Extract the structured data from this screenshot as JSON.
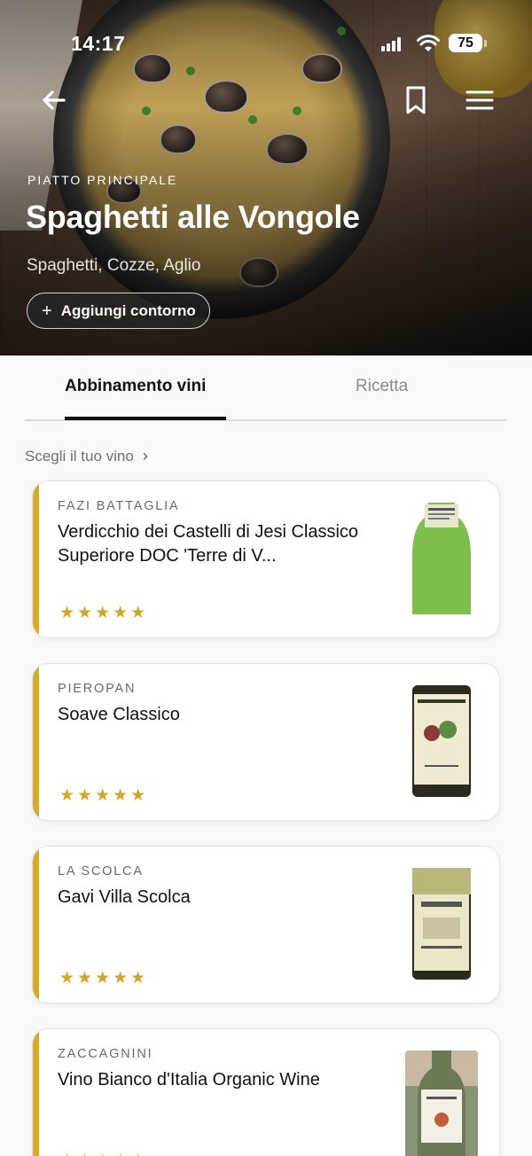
{
  "status": {
    "time": "14:17",
    "battery": "75"
  },
  "hero": {
    "course": "PIATTO PRINCIPALE",
    "title": "Spaghetti alle Vongole",
    "ingredients": "Spaghetti, Cozze, Aglio",
    "add_side_label": "Aggiungi contorno"
  },
  "tabs": [
    {
      "label": "Abbinamento vini",
      "active": true
    },
    {
      "label": "Ricetta",
      "active": false
    }
  ],
  "choose_label": "Scegli il tuo vino",
  "wines": [
    {
      "producer": "FAZI BATTAGLIA",
      "name": "Verdicchio dei Castelli di Jesi Classico Superiore DOC 'Terre di V...",
      "rating": "★★★★★",
      "bottle_color": "#7cbf4a",
      "label_color": "#e9e4cf"
    },
    {
      "producer": "PIEROPAN",
      "name": "Soave Classico",
      "rating": "★★★★★",
      "bottle_color": "#2b2a1e",
      "label_color": "#f1ead2"
    },
    {
      "producer": "LA SCOLCA",
      "name": "Gavi Villa Scolca",
      "rating": "★★★★★",
      "bottle_color": "#2a2a1a",
      "label_color": "#ece6c8"
    },
    {
      "producer": "ZACCAGNINI",
      "name": "Vino Bianco d'Italia Organic Wine",
      "rating": "★★★★★",
      "bottle_color": "#6b7a55",
      "label_color": "#f2efe6"
    }
  ],
  "colors": {
    "accent": "#d4ab2b",
    "text": "#111111",
    "muted": "#6f6f6f"
  },
  "icons": [
    "back-arrow-icon",
    "bookmark-icon",
    "hamburger-menu-icon",
    "plus-icon",
    "chevron-right-icon",
    "star-icon",
    "signal-icon",
    "wifi-icon",
    "battery-icon"
  ]
}
